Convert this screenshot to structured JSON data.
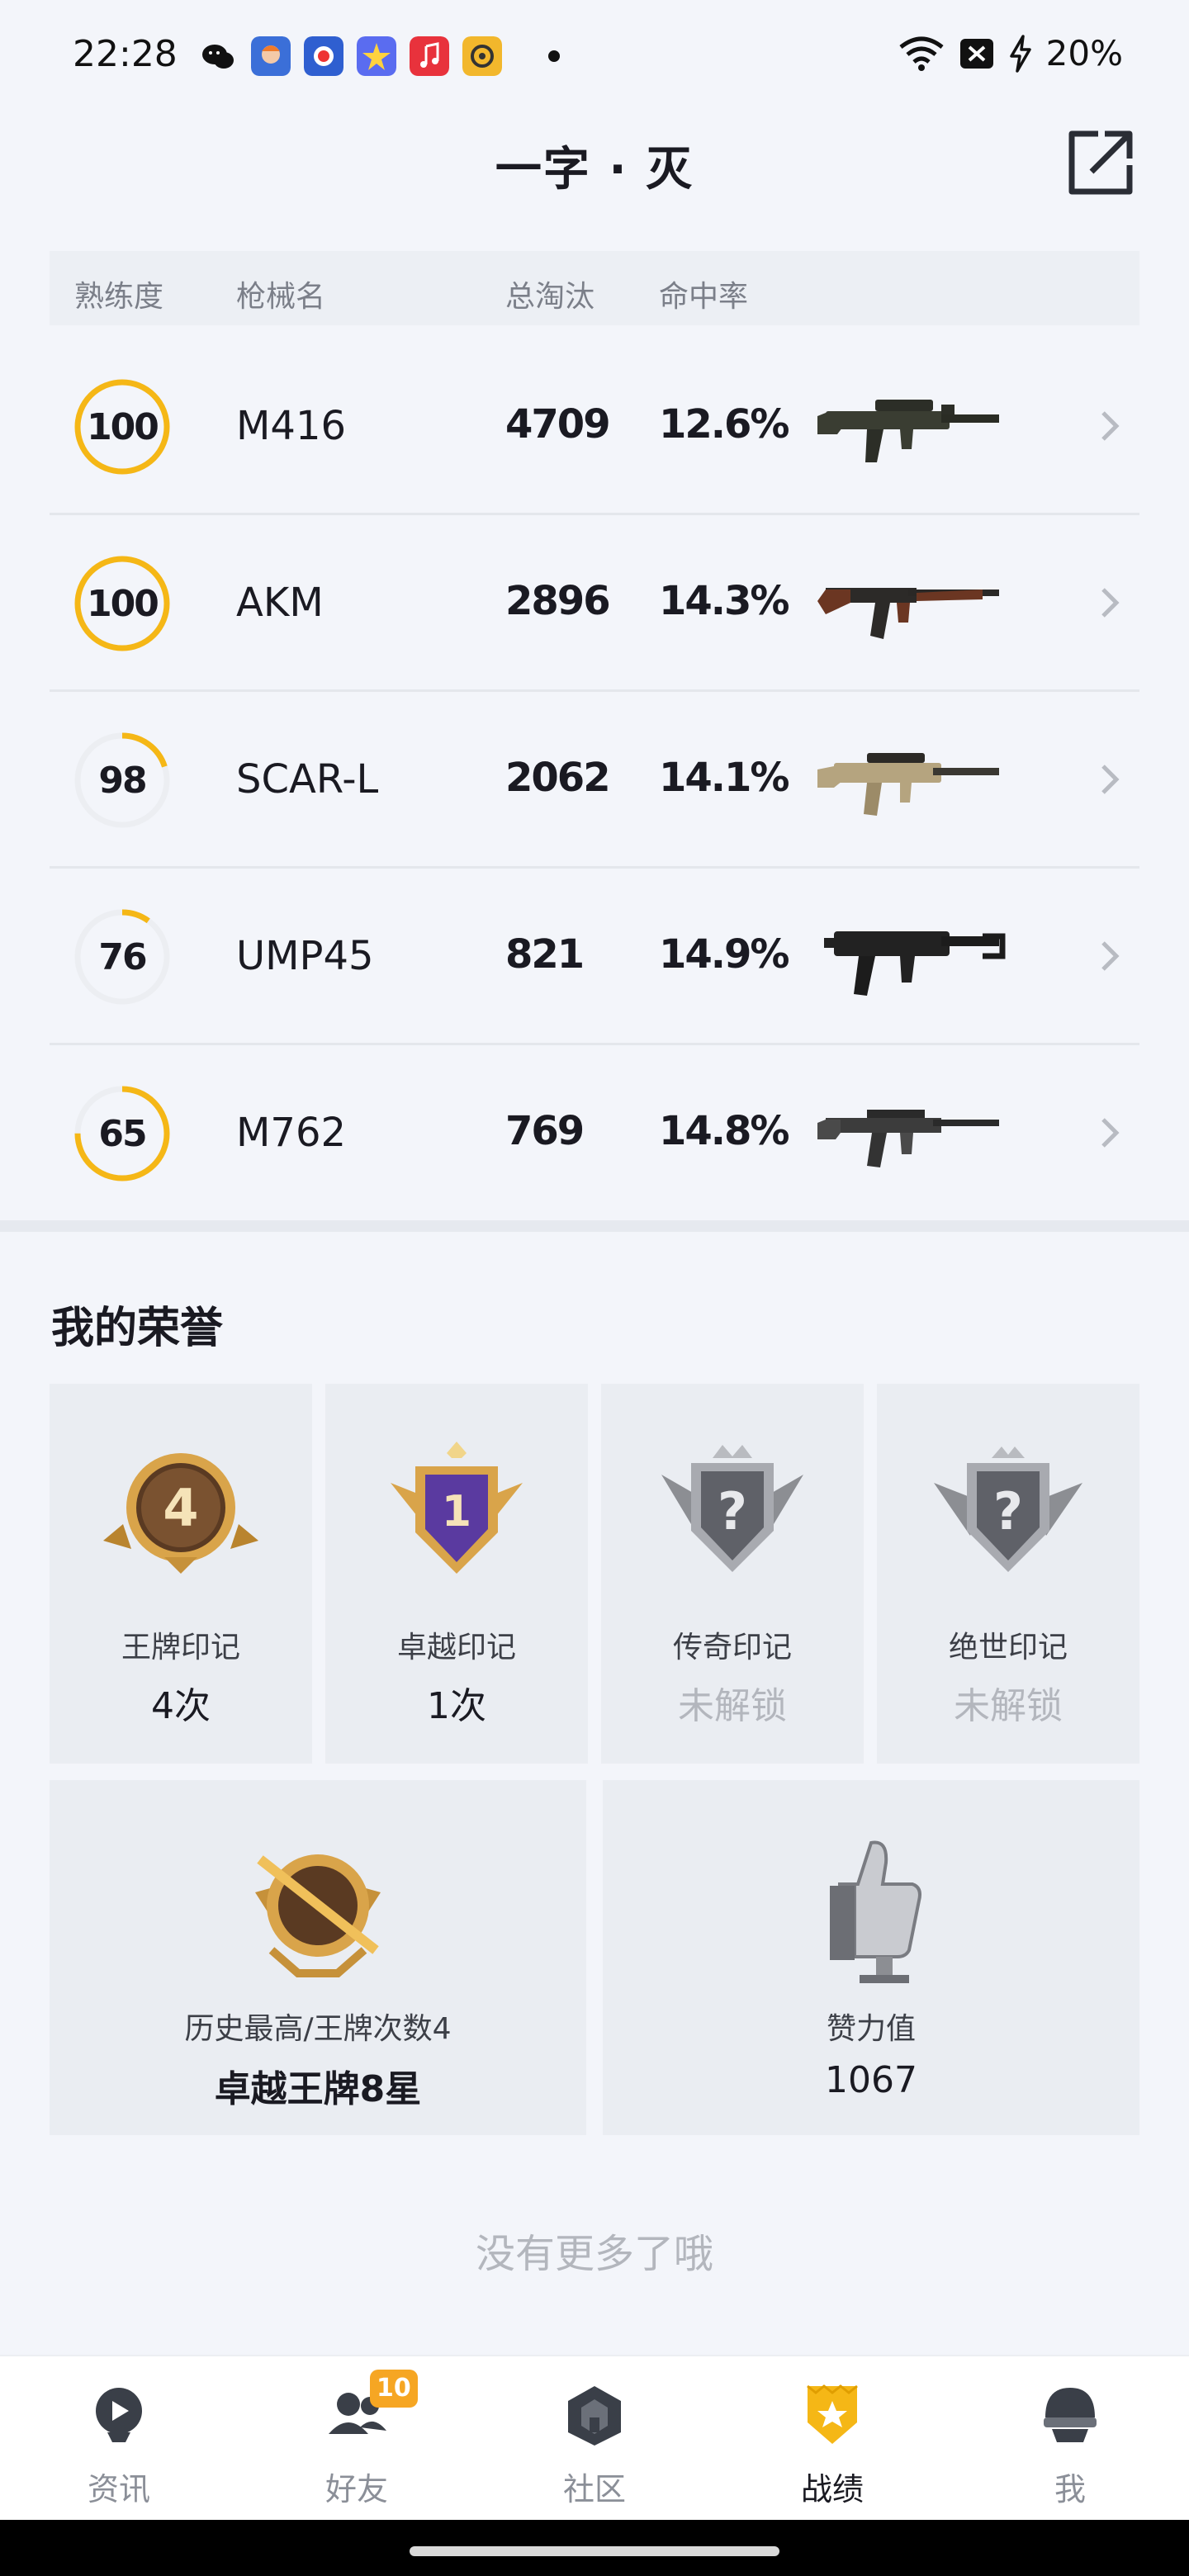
{
  "status_bar": {
    "time": "22:28",
    "battery": "20%",
    "icons": [
      "wechat-icon",
      "game-app-icon",
      "game-app-icon-2",
      "star-app-icon",
      "music-app-icon",
      "circle-app-icon",
      "notification-dot",
      "wifi-icon",
      "sim-off-icon",
      "charging-icon"
    ]
  },
  "header": {
    "title": "一字 · 灭",
    "share_icon": "share-out-icon"
  },
  "table": {
    "headers": {
      "mastery": "熟练度",
      "weapon": "枪械名",
      "kills": "总淘汰",
      "accuracy": "命中率"
    },
    "rows": [
      {
        "mastery": "100",
        "mastery_fraction": 1.0,
        "name": "M416",
        "kills": "4709",
        "accuracy": "12.6%",
        "image": "m416-rifle-image"
      },
      {
        "mastery": "100",
        "mastery_fraction": 1.0,
        "name": "AKM",
        "kills": "2896",
        "accuracy": "14.3%",
        "image": "akm-rifle-image"
      },
      {
        "mastery": "98",
        "mastery_fraction": 0.2,
        "name": "SCAR-L",
        "kills": "2062",
        "accuracy": "14.1%",
        "image": "scar-l-rifle-image"
      },
      {
        "mastery": "76",
        "mastery_fraction": 0.1,
        "name": "UMP45",
        "kills": "821",
        "accuracy": "14.9%",
        "image": "ump45-smg-image"
      },
      {
        "mastery": "65",
        "mastery_fraction": 0.75,
        "name": "M762",
        "kills": "769",
        "accuracy": "14.8%",
        "image": "m762-rifle-image"
      }
    ]
  },
  "honors": {
    "title": "我的荣誉",
    "badges": [
      {
        "label": "王牌印记",
        "value": "4次",
        "locked": false,
        "icon": "ace-mark-badge-icon"
      },
      {
        "label": "卓越印记",
        "value": "1次",
        "locked": false,
        "icon": "excellence-mark-badge-icon"
      },
      {
        "label": "传奇印记",
        "value": "未解锁",
        "locked": true,
        "icon": "legend-mark-locked-icon"
      },
      {
        "label": "绝世印记",
        "value": "未解锁",
        "locked": true,
        "icon": "peerless-mark-locked-icon"
      }
    ],
    "summary": [
      {
        "label": "历史最高/王牌次数4",
        "value": "卓越王牌8星",
        "icon": "highest-rank-badge-icon"
      },
      {
        "label": "赞力值",
        "value": "1067",
        "icon": "thumbs-up-trophy-icon"
      }
    ]
  },
  "footer_text": "没有更多了哦",
  "bottom_nav": {
    "items": [
      {
        "label": "资讯",
        "icon": "news-icon",
        "active": false
      },
      {
        "label": "好友",
        "icon": "friends-icon",
        "active": false,
        "badge": "10"
      },
      {
        "label": "社区",
        "icon": "community-icon",
        "active": false
      },
      {
        "label": "战绩",
        "icon": "record-shield-icon",
        "active": true
      },
      {
        "label": "我",
        "icon": "helmet-profile-icon",
        "active": false
      }
    ]
  },
  "colors": {
    "accent": "#f5b716",
    "ring_track": "#eceef2",
    "locked_text": "#b3b6bd",
    "badge_orange": "#f6a623"
  }
}
